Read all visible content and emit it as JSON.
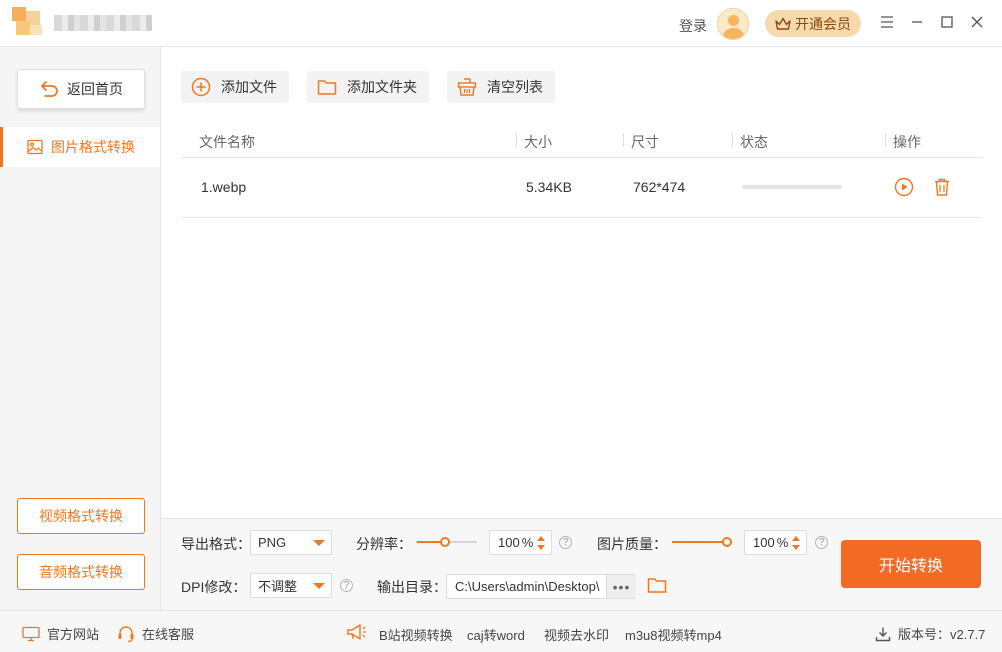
{
  "titlebar": {
    "login": "登录",
    "vip_button": "开通会员"
  },
  "sidebar": {
    "back_home": "返回首页",
    "active_item": "图片格式转换",
    "bottom_buttons": [
      "视频格式转换",
      "音频格式转换"
    ]
  },
  "toolbar": {
    "add_file": "添加文件",
    "add_folder": "添加文件夹",
    "clear_list": "清空列表"
  },
  "table": {
    "columns": [
      "文件名称",
      "大小",
      "尺寸",
      "状态",
      "操作"
    ],
    "rows": [
      {
        "name": "1.webp",
        "size": "5.34KB",
        "dimensions": "762*474",
        "progress": 0
      }
    ]
  },
  "settings": {
    "export_format_label": "导出格式：",
    "export_format_value": "PNG",
    "resolution_label": "分辨率：",
    "resolution_value": "100",
    "resolution_unit": "%",
    "quality_label": "图片质量：",
    "quality_value": "100",
    "quality_unit": "%",
    "dpi_label": "DPI修改：",
    "dpi_value": "不调整",
    "output_dir_label": "输出目录：",
    "output_dir_value": "C:\\Users\\admin\\Desktop\\",
    "more": "•••",
    "start_button": "开始转换"
  },
  "statusbar": {
    "official_site": "官方网站",
    "online_service": "在线客服",
    "links": [
      "B站视频转换",
      "caj转word",
      "视频去水印",
      "m3u8视频转mp4"
    ],
    "version_label": "版本号：v2.7.7"
  },
  "colors": {
    "accent": "#f0771f",
    "start_button": "#f36a24",
    "vip_bg": "#f7d9ae"
  }
}
